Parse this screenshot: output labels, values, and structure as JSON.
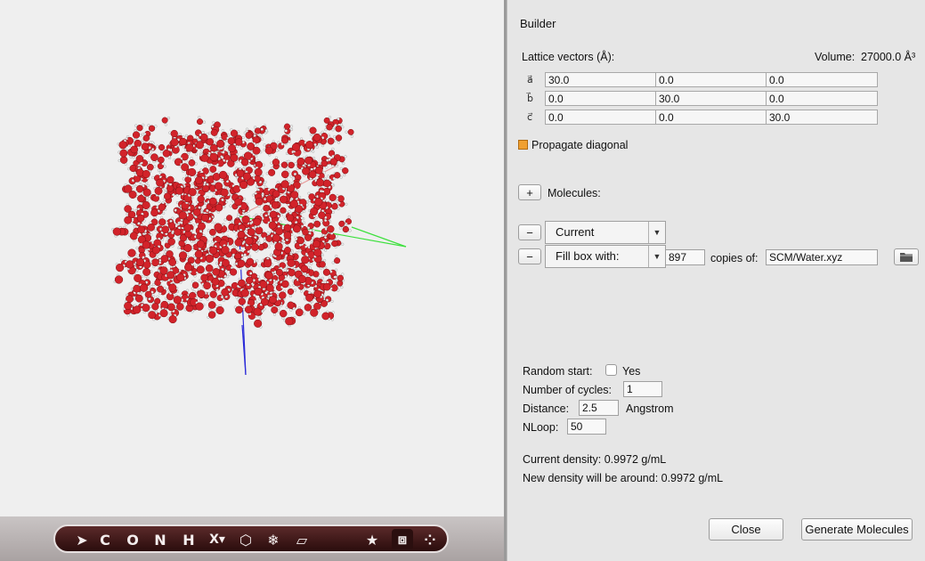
{
  "panel": {
    "title": "Builder",
    "lattice_label": "Lattice vectors (Å):",
    "volume_label": "Volume:",
    "volume_value": "27000.0 Å³",
    "vector_labels": [
      "a⃗",
      "b⃗",
      "c⃗"
    ],
    "lattice": [
      [
        "30.0",
        "0.0",
        "0.0"
      ],
      [
        "0.0",
        "30.0",
        "0.0"
      ],
      [
        "0.0",
        "0.0",
        "30.0"
      ]
    ],
    "propagate_diagonal": "Propagate diagonal",
    "add_button": "+",
    "molecules_label": "Molecules:",
    "remove_button": "−",
    "molecule_rows": [
      {
        "mode": "Current"
      },
      {
        "mode": "Fill box with:",
        "copies": "897",
        "copies_label": "copies of:",
        "file": "SCM/Water.xyz"
      }
    ],
    "random_start_label": "Random start:",
    "random_start_option": "Yes",
    "cycles_label": "Number of cycles:",
    "cycles_value": "1",
    "distance_label": "Distance:",
    "distance_value": "2.5",
    "distance_unit": "Angstrom",
    "nloop_label": "NLoop:",
    "nloop_value": "50",
    "current_density": "Current density: 0.9972 g/mL",
    "new_density": "New density will be around: 0.9972 g/mL",
    "close_button": "Close",
    "generate_button": "Generate Molecules"
  },
  "toolbar": {
    "tools": [
      {
        "icon": "select-arrow-icon",
        "glyph": "➤"
      },
      {
        "icon": "carbon-element",
        "glyph": "C"
      },
      {
        "icon": "oxygen-element",
        "glyph": "O"
      },
      {
        "icon": "nitrogen-element",
        "glyph": "N"
      },
      {
        "icon": "hydrogen-element",
        "glyph": "H"
      },
      {
        "icon": "other-element-menu",
        "glyph": "X▾"
      },
      {
        "icon": "ring-icon",
        "glyph": "⬡"
      },
      {
        "icon": "crystal-snowflake-icon",
        "glyph": "❄"
      },
      {
        "icon": "plane-icon",
        "glyph": "▱"
      },
      {
        "icon": "favorite-star-icon",
        "glyph": "★"
      },
      {
        "icon": "periodic-box-icon",
        "glyph": "⧈"
      },
      {
        "icon": "molecules-icon",
        "glyph": "⁘"
      }
    ]
  },
  "colors": {
    "oxygen": "#d2232a",
    "hydrogen": "#f0f0f0",
    "axis_x": "#e89a9a",
    "axis_y": "#3ee03e",
    "axis_z": "#2b2bd8",
    "checkbox_checked": "#f0a030"
  }
}
